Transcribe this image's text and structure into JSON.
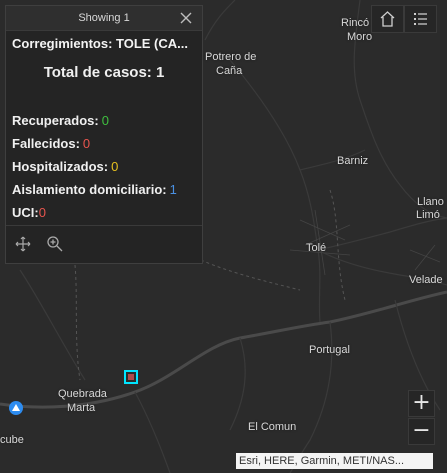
{
  "popup": {
    "header": "Showing 1",
    "title": "Corregimientos: TOLE (CA...",
    "total": "Total de casos: 1",
    "stats": [
      {
        "label": "Recuperados:",
        "value": "0",
        "color": "#3fbf3f"
      },
      {
        "label": "Fallecidos:",
        "value": "0",
        "color": "#e8554e"
      },
      {
        "label": "Hospitalizados:",
        "value": "0",
        "color": "#e6c020"
      },
      {
        "label": "Aislamiento domiciliario:",
        "value": "1",
        "color": "#4a90e2"
      },
      {
        "label": "UCI:",
        "value": "0",
        "color": "#e8554e"
      }
    ],
    "footer_icons": [
      "move-icon",
      "zoom-to-icon"
    ]
  },
  "places": {
    "rincon_moro_1": "Rincó",
    "rincon_moro_2": "Moro",
    "potrero_1": "Potrero de",
    "potrero_2": "Caña",
    "barniz": "Barniz",
    "llano_1": "Llano",
    "llano_2": "Limó",
    "tole": "Tolé",
    "velade": "Velade",
    "portugal": "Portugal",
    "quebrada_1": "Quebrada",
    "quebrada_2": "Marta",
    "el_comun": "El Comun",
    "cube": "cube"
  },
  "zoom": {
    "in": "+",
    "out": "−"
  },
  "attribution": "Esri, HERE, Garmin, METI/NAS...",
  "colors": {
    "highlight": "#00e5ff",
    "marker": "#2d8cf0"
  }
}
